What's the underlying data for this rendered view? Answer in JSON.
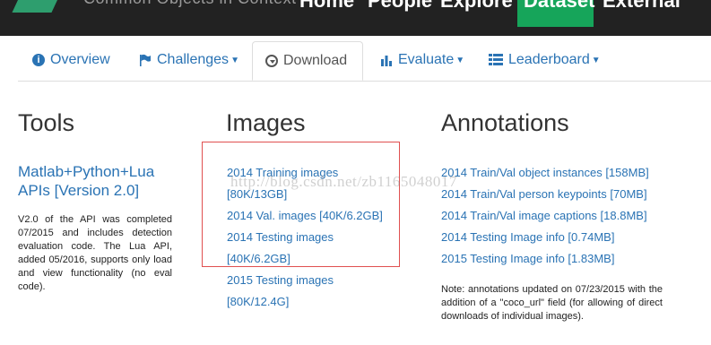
{
  "topnav": {
    "logo_text": "Common Objects in Context",
    "items": [
      "Home",
      "People",
      "Explore",
      "Dataset",
      "External"
    ],
    "active": "Dataset"
  },
  "tabs": {
    "overview": "Overview",
    "challenges": "Challenges",
    "download": "Download",
    "evaluate": "Evaluate",
    "leaderboard": "Leaderboard"
  },
  "tools": {
    "title": "Tools",
    "api_link": "Matlab+Python+Lua APIs [Version 2.0]",
    "description": "V2.0 of the API was completed 07/2015 and includes detection evaluation code. The Lua API, added 05/2016, supports only load and view functionality (no eval code)."
  },
  "images": {
    "title": "Images",
    "links": [
      "2014 Training images",
      "[80K/13GB]",
      "2014 Val. images [40K/6.2GB]",
      "2014 Testing images",
      "[40K/6.2GB]",
      "2015 Testing images",
      "[80K/12.4G]"
    ]
  },
  "annotations": {
    "title": "Annotations",
    "links": [
      "2014 Train/Val object instances [158MB]",
      "2014 Train/Val person keypoints [70MB]",
      "2014 Train/Val image captions [18.8MB]",
      "2014 Testing Image info [0.74MB]",
      "2015 Testing Image info [1.83MB]"
    ],
    "note": "Note: annotations updated on 07/23/2015 with the addition of a \"coco_url\" field (for allowing of direct downloads of individual images)."
  },
  "watermark": "http://blog.csdn.net/zb1165048017",
  "colors": {
    "link": "#2a73b4",
    "navbar": "#222222",
    "active": "#16a55a",
    "highlight_box": "#e05050"
  }
}
